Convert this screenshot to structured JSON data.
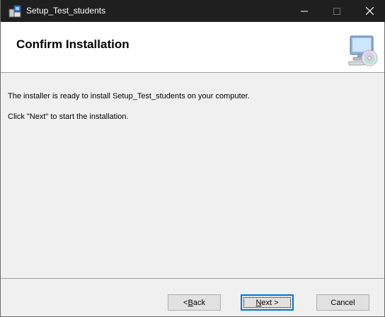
{
  "window": {
    "title": "Setup_Test_students",
    "controls": {
      "minimize": "—",
      "maximize": "☐",
      "close": "✕"
    }
  },
  "banner": {
    "title": "Confirm Installation",
    "icon": "computer-cd-icon"
  },
  "content": {
    "line1": "The installer is ready to install Setup_Test_students on your computer.",
    "line2": "Click \"Next\" to start the installation."
  },
  "buttons": {
    "back": {
      "prefix": "< ",
      "accel": "B",
      "rest": "ack"
    },
    "next": {
      "accel": "N",
      "rest": "ext >"
    },
    "cancel": "Cancel"
  },
  "colors": {
    "titlebar": "#1f1f1f",
    "focus": "#0078d7",
    "background": "#f0f0f0"
  }
}
